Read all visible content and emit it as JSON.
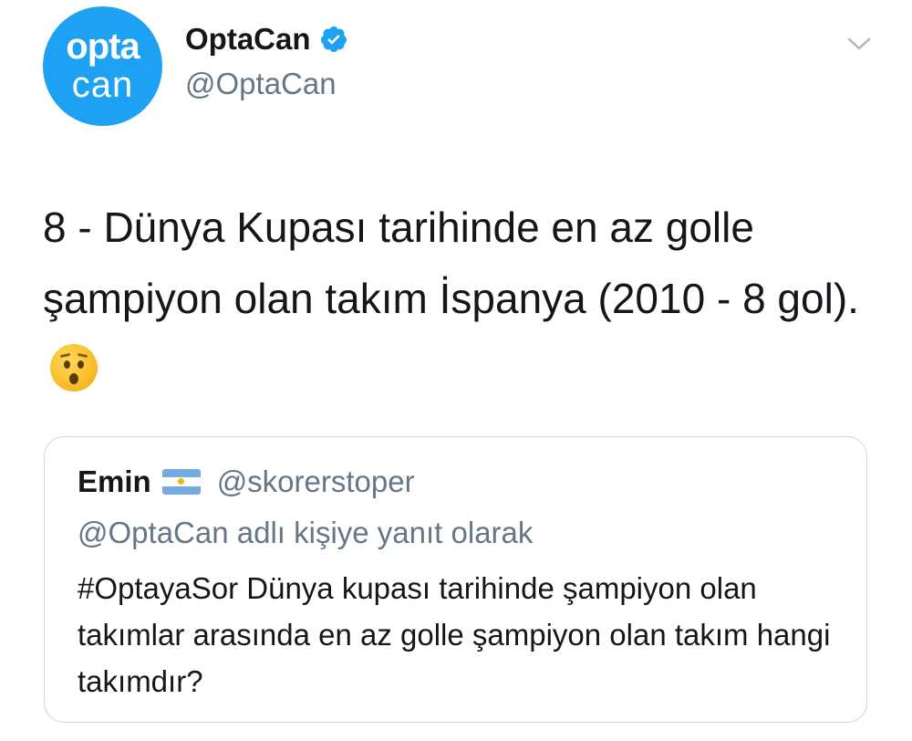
{
  "author": {
    "avatar_line1": "opta",
    "avatar_line2": "can",
    "display_name": "OptaCan",
    "handle": "@OptaCan",
    "verified": true,
    "avatar_color": "#1da1f2"
  },
  "menu_icon": "chevron-down-icon",
  "tweet": {
    "text": "8 - Dünya Kupası tarihinde en az golle şampiyon olan takım İspanya (2010 - 8 gol).",
    "emoji": "hushed-face-emoji"
  },
  "quoted_tweet": {
    "display_name": "Emin",
    "flag": "argentina-flag",
    "handle": "@skorerstoper",
    "reply_context": "@OptaCan adlı kişiye yanıt olarak",
    "text": "#OptayaSor Dünya kupası tarihinde şampiyon olan takımlar arasında en az golle şampiyon olan takım hangi takımdır?"
  },
  "colors": {
    "text_primary": "#14171a",
    "text_secondary": "#657786",
    "border": "#ccd6dd",
    "verified_badge": "#1da1f2"
  }
}
